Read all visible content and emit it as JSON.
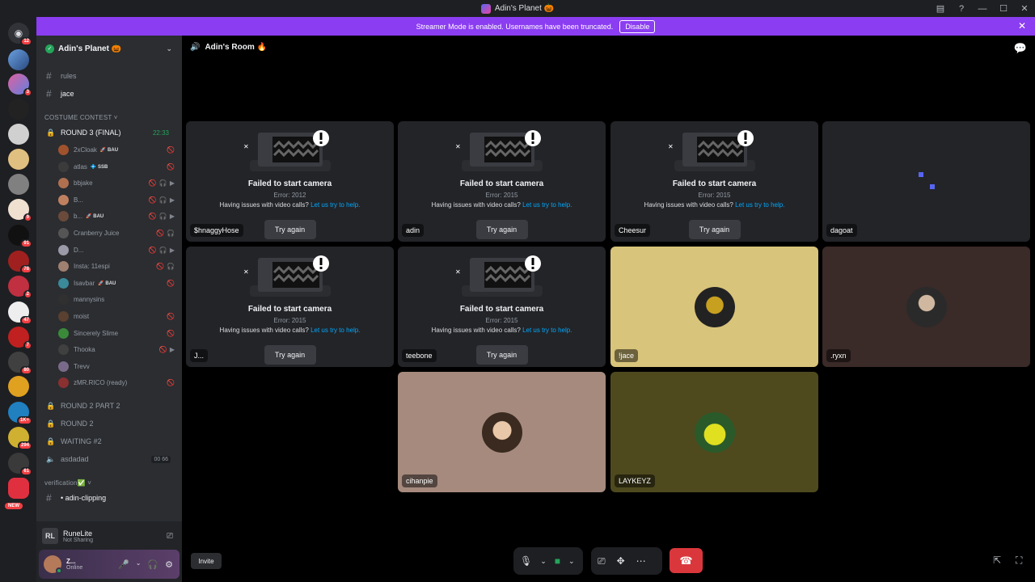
{
  "titlebar": {
    "title": "Adin's Planet 🎃"
  },
  "banner": {
    "text": "Streamer Mode is enabled. Usernames have been truncated.",
    "disable_label": "Disable"
  },
  "guilds": [
    {
      "badge": "12"
    },
    {
      "badge": ""
    },
    {
      "badge": "3"
    },
    {
      "badge": ""
    },
    {
      "badge": ""
    },
    {
      "badge": ""
    },
    {
      "badge": ""
    },
    {
      "badge": "9"
    },
    {
      "badge": "91"
    },
    {
      "badge": "78"
    },
    {
      "badge": "2"
    },
    {
      "badge": "47"
    },
    {
      "badge": "7"
    },
    {
      "badge": "80"
    },
    {
      "badge": ""
    },
    {
      "badge": "1K+"
    },
    {
      "badge": "294"
    },
    {
      "badge": "61"
    },
    {
      "badge": "NEW"
    }
  ],
  "server": {
    "name": "Adin's Planet 🎃"
  },
  "channels": {
    "rules": "rules",
    "jace": "jace",
    "cat_costume": "COSTUME CONTEST ˅",
    "round3": "ROUND 3 (FINAL)",
    "round3_time": "22:33",
    "round3_part2": "ROUND 2 PART 2",
    "round2": "ROUND 2",
    "waiting": "WAITING #2",
    "asdadad": "asdadad",
    "asdadad_counts": "00  66",
    "cat_verification": "verification✅ ˅",
    "adin_clipping": "• adin-clipping"
  },
  "voice_users": [
    {
      "name": "2xCloak",
      "tag": "🚀 BAU",
      "color": "#a0522d"
    },
    {
      "name": "atlas",
      "tag": "💠 SSB",
      "color": "#3b3b3b"
    },
    {
      "name": "bbjake",
      "tag": "",
      "color": "#b07050"
    },
    {
      "name": "B...",
      "tag": "",
      "color": "#c08060"
    },
    {
      "name": "b...",
      "tag": "🚀 BAU",
      "color": "#6a4a3a"
    },
    {
      "name": "Cranberry Juice",
      "tag": "",
      "color": "#555"
    },
    {
      "name": "D...",
      "tag": "",
      "color": "#9a9aa8"
    },
    {
      "name": "Insta: 11espi",
      "tag": "",
      "color": "#a08070"
    },
    {
      "name": "Isavbar",
      "tag": "🚀 BAU",
      "color": "#3a8a9a"
    },
    {
      "name": "mannysins",
      "tag": "",
      "color": "#303030"
    },
    {
      "name": "moist",
      "tag": "",
      "color": "#5a4030"
    },
    {
      "name": "Sincerely Slime",
      "tag": "",
      "color": "#3a8a3a"
    },
    {
      "name": "Thooka",
      "tag": "",
      "color": "#404040"
    },
    {
      "name": "Trevv",
      "tag": "",
      "color": "#7a6a8a"
    },
    {
      "name": "zMR.RICO (ready)",
      "tag": "",
      "color": "#8a3030"
    }
  ],
  "activity": {
    "app": "RuneLite",
    "status": "Not Sharing",
    "logo": "RL"
  },
  "me": {
    "name": "Z...",
    "status": "Online"
  },
  "voice": {
    "room": "Adin's Room 🔥"
  },
  "error": {
    "title": "Failed to start camera",
    "help_prefix": "Having issues with video calls?",
    "help_link": "Let us try to help.",
    "try_again": "Try again"
  },
  "tiles": [
    {
      "name": "$hnaggyHose",
      "error": "Error: 2012"
    },
    {
      "name": "adin",
      "error": "Error: 2015"
    },
    {
      "name": "Cheesur",
      "error": "Error: 2015"
    },
    {
      "name": "dagoat"
    },
    {
      "name": "J...",
      "error": "Error: 2015"
    },
    {
      "name": "teebone",
      "error": "Error: 2015"
    },
    {
      "name": "!jace"
    },
    {
      "name": ".ryxn"
    },
    {
      "name": "cihanpie"
    },
    {
      "name": "LAYKEYZ"
    }
  ],
  "controls": {
    "invite": "Invite"
  },
  "colors": {
    "accent": "#5865f2",
    "banner": "#8b3df2",
    "hangup": "#da373c",
    "online": "#23a55a",
    "link": "#00a8fc"
  }
}
